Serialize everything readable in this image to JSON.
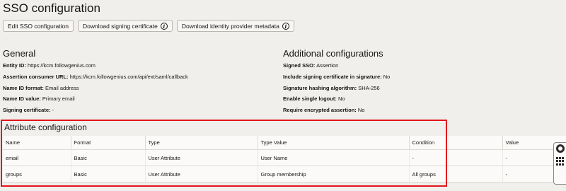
{
  "page": {
    "title": "SSO configuration"
  },
  "toolbar": {
    "edit_label": "Edit SSO configuration",
    "download_cert_label": "Download signing certificate",
    "download_meta_label": "Download identity provider metadata",
    "info_glyph": "i"
  },
  "general": {
    "heading": "General",
    "entity_id": {
      "label": "Entity ID:",
      "value": "https://kcm.followgenius.com"
    },
    "acs_url": {
      "label": "Assertion consumer URL:",
      "value": "https://kcm.followgenius.com/api/ext/saml/callback"
    },
    "name_id_format": {
      "label": "Name ID format:",
      "value": "Email address"
    },
    "name_id_value": {
      "label": "Name ID value:",
      "value": "Primary email"
    },
    "signing_cert": {
      "label": "Signing certificate:",
      "value": "-"
    }
  },
  "additional": {
    "heading": "Additional configurations",
    "signed_sso": {
      "label": "Signed SSO:",
      "value": "Assertion"
    },
    "include_cert": {
      "label": "Include signing certificate in signature:",
      "value": "No"
    },
    "hash_algo": {
      "label": "Signature hashing algorithm:",
      "value": "SHA-256"
    },
    "single_logout": {
      "label": "Enable single logout:",
      "value": "No"
    },
    "encrypted_assertion": {
      "label": "Require encrypted assertion:",
      "value": "No"
    }
  },
  "attributes": {
    "heading": "Attribute configuration",
    "columns": [
      "Name",
      "Format",
      "Type",
      "Type Value",
      "Condition",
      "Value"
    ],
    "rows": [
      [
        "email",
        "Basic",
        "User Attribute",
        "User Name",
        "-",
        "-"
      ],
      [
        "groups",
        "Basic",
        "User Attribute",
        "Group membership",
        "All groups",
        "-"
      ]
    ]
  },
  "colors": {
    "highlight": "#e3151a",
    "background": "#f1efec"
  },
  "side_widget": {
    "icons": [
      "lifebuoy-icon",
      "grid-icon"
    ]
  }
}
